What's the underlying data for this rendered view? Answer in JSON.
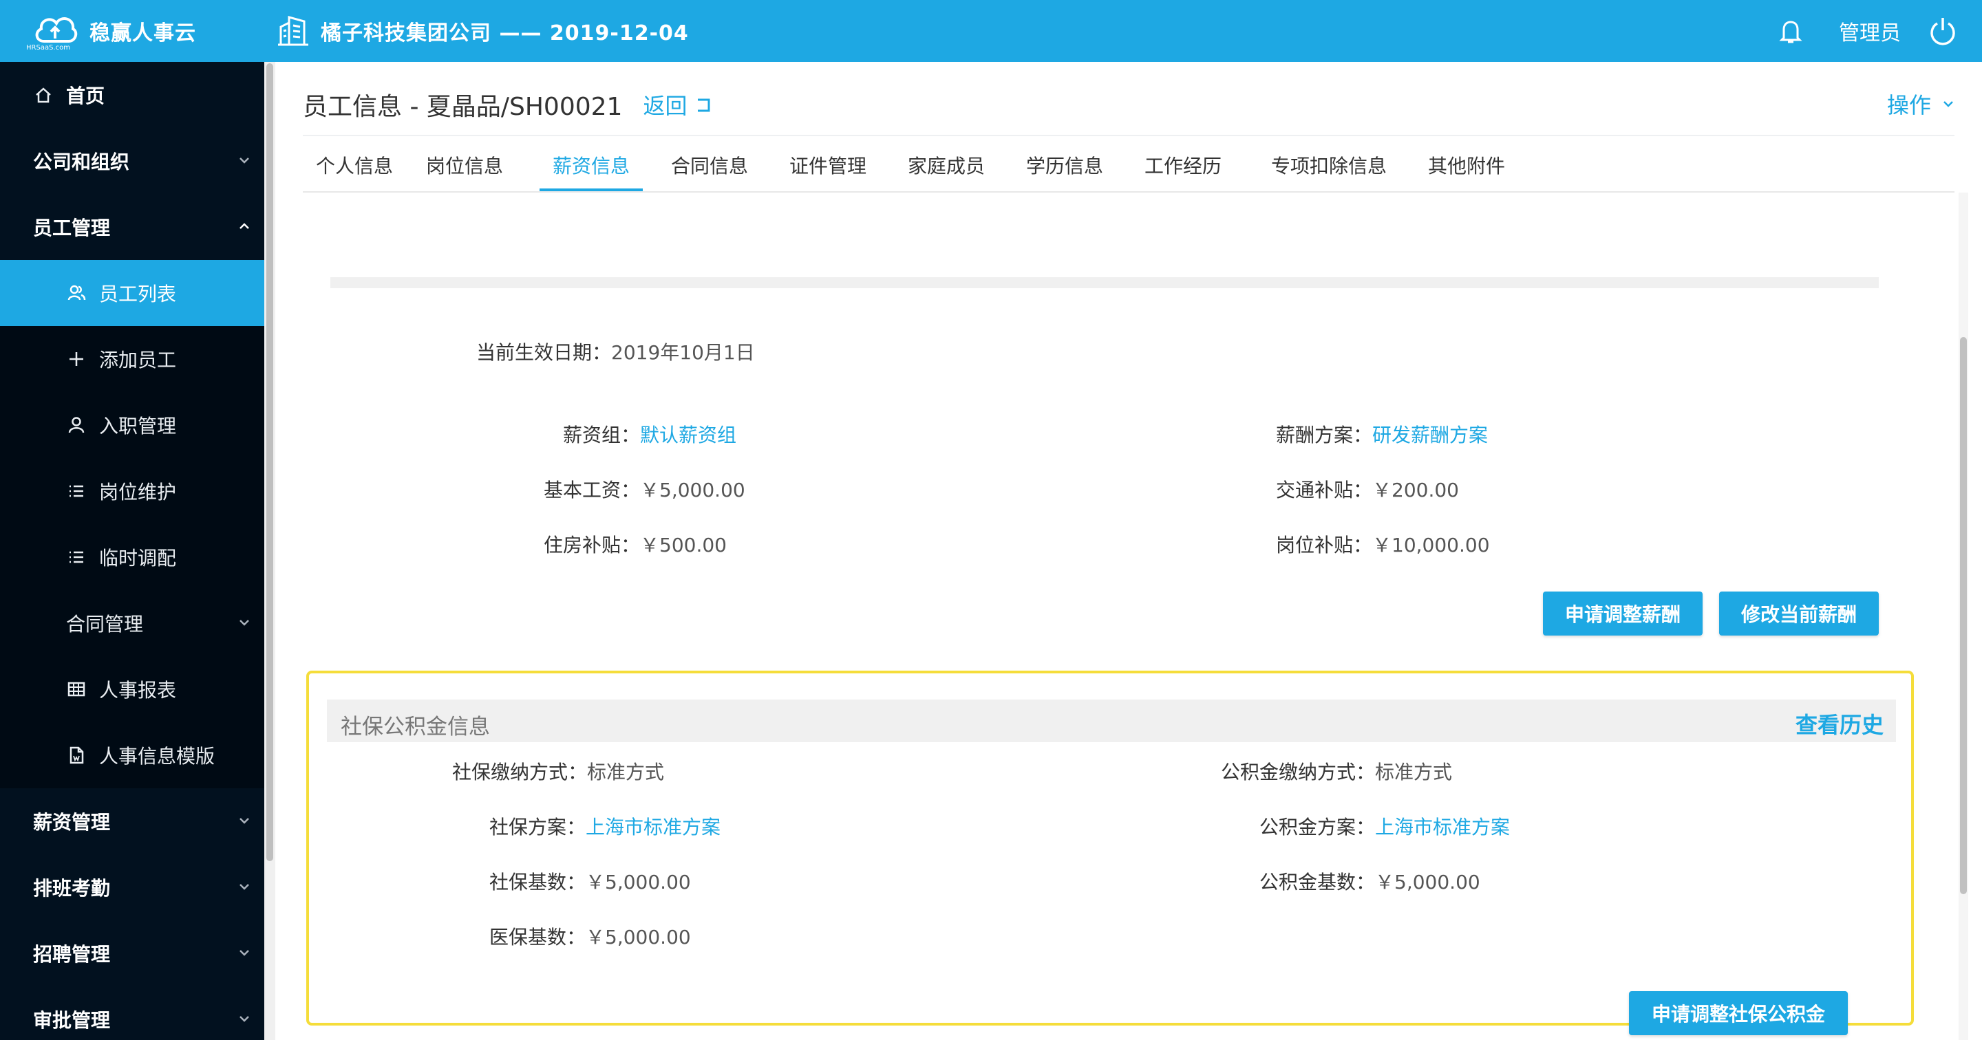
{
  "header": {
    "brand_name": "稳赢人事云",
    "brand_sub": "HRSaaS.com",
    "company": "橘子科技集团公司 —— 2019-12-04",
    "user": "管理员"
  },
  "sidebar": {
    "items": [
      {
        "label": "首页"
      },
      {
        "label": "公司和组织"
      },
      {
        "label": "员工管理"
      },
      {
        "label": "员工列表"
      },
      {
        "label": "添加员工"
      },
      {
        "label": "入职管理"
      },
      {
        "label": "岗位维护"
      },
      {
        "label": "临时调配"
      },
      {
        "label": "合同管理"
      },
      {
        "label": "人事报表"
      },
      {
        "label": "人事信息模版"
      },
      {
        "label": "薪资管理"
      },
      {
        "label": "排班考勤"
      },
      {
        "label": "招聘管理"
      },
      {
        "label": "审批管理"
      }
    ]
  },
  "page": {
    "title": "员工信息 - 夏晶品/SH00021",
    "back": "返回",
    "ops": "操作"
  },
  "tabs": [
    "个人信息",
    "岗位信息",
    "薪资信息",
    "合同信息",
    "证件管理",
    "家庭成员",
    "学历信息",
    "工作经历",
    "专项扣除信息",
    "其他附件"
  ],
  "salary": {
    "effective_label": "当前生效日期：",
    "effective_value": "2019年10月1日",
    "group_label": "薪资组：",
    "group_value": "默认薪资组",
    "plan_label": "薪酬方案：",
    "plan_value": "研发薪酬方案",
    "base_label": "基本工资：",
    "base_value": "￥5,000.00",
    "transport_label": "交通补贴：",
    "transport_value": "￥200.00",
    "housing_label": "住房补贴：",
    "housing_value": "￥500.00",
    "post_label": "岗位补贴：",
    "post_value": "￥10,000.00",
    "btn_apply": "申请调整薪酬",
    "btn_modify": "修改当前薪酬"
  },
  "social": {
    "title": "社保公积金信息",
    "history": "查看历史",
    "ss_method_label": "社保缴纳方式：",
    "ss_method_value": "标准方式",
    "hf_method_label": "公积金缴纳方式：",
    "hf_method_value": "标准方式",
    "ss_plan_label": "社保方案：",
    "ss_plan_value": "上海市标准方案",
    "hf_plan_label": "公积金方案：",
    "hf_plan_value": "上海市标准方案",
    "ss_base_label": "社保基数：",
    "ss_base_value": "￥5,000.00",
    "hf_base_label": "公积金基数：",
    "hf_base_value": "￥5,000.00",
    "med_base_label": "医保基数：",
    "med_base_value": "￥5,000.00",
    "btn_apply": "申请调整社保公积金"
  },
  "colors": {
    "accent": "#1ea8e3",
    "sidebar_bg": "#02111f",
    "highlight_border": "#f5dd3a"
  }
}
